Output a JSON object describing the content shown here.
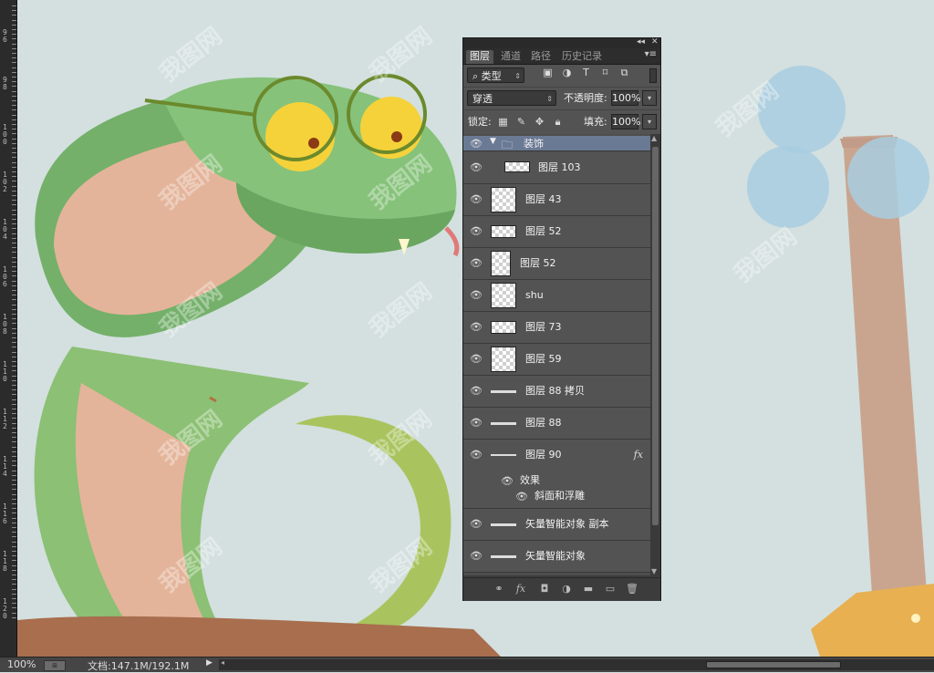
{
  "ruler": {
    "labels": [
      "96",
      "98",
      "100",
      "102",
      "104",
      "106",
      "108",
      "110",
      "112",
      "114",
      "116",
      "118",
      "120"
    ]
  },
  "canvas": {
    "watermark": "我图网",
    "background": "#d3e0df"
  },
  "panel": {
    "window_controls": {
      "collapse": "◂◂",
      "close": "✕"
    },
    "tabs": [
      {
        "label": "图层",
        "active": true
      },
      {
        "label": "通道",
        "active": false
      },
      {
        "label": "路径",
        "active": false
      },
      {
        "label": "历史记录",
        "active": false
      }
    ],
    "filter": {
      "label": "类型",
      "icons": [
        "image-filter-icon",
        "adjustment-filter-icon",
        "type-filter-icon",
        "shape-filter-icon",
        "smart-object-filter-icon"
      ]
    },
    "blend_mode": "穿透",
    "opacity_label": "不透明度:",
    "opacity_value": "100%",
    "lock_label": "锁定:",
    "fill_label": "填充:",
    "fill_value": "100%",
    "group": {
      "name": "装饰"
    },
    "layers": [
      {
        "name": "图层 103",
        "thumb": "line"
      },
      {
        "name": "图层 43",
        "thumb": "image"
      },
      {
        "name": "图层 52",
        "thumb": "image"
      },
      {
        "name": "图层 52",
        "thumb": "image"
      },
      {
        "name": "shu",
        "thumb": "image"
      },
      {
        "name": "图层 73",
        "thumb": "image"
      },
      {
        "name": "图层 59",
        "thumb": "image"
      },
      {
        "name": "图层 88 拷贝",
        "thumb": "line"
      },
      {
        "name": "图层 88",
        "thumb": "line"
      },
      {
        "name": "图层 90",
        "thumb": "line",
        "fx": "fx"
      }
    ],
    "effects_label": "效果",
    "effect_item": "斜面和浮雕",
    "smart_layers": [
      {
        "name": "矢量智能对象 副本"
      },
      {
        "name": "矢量智能对象"
      }
    ],
    "bottom_icons": [
      "link-layers-icon",
      "fx-icon",
      "mask-icon",
      "adjustment-icon",
      "new-group-icon",
      "new-layer-icon",
      "trash-icon"
    ]
  },
  "status": {
    "zoom": "100%",
    "doc_info": "文档:147.1M/192.1M"
  }
}
